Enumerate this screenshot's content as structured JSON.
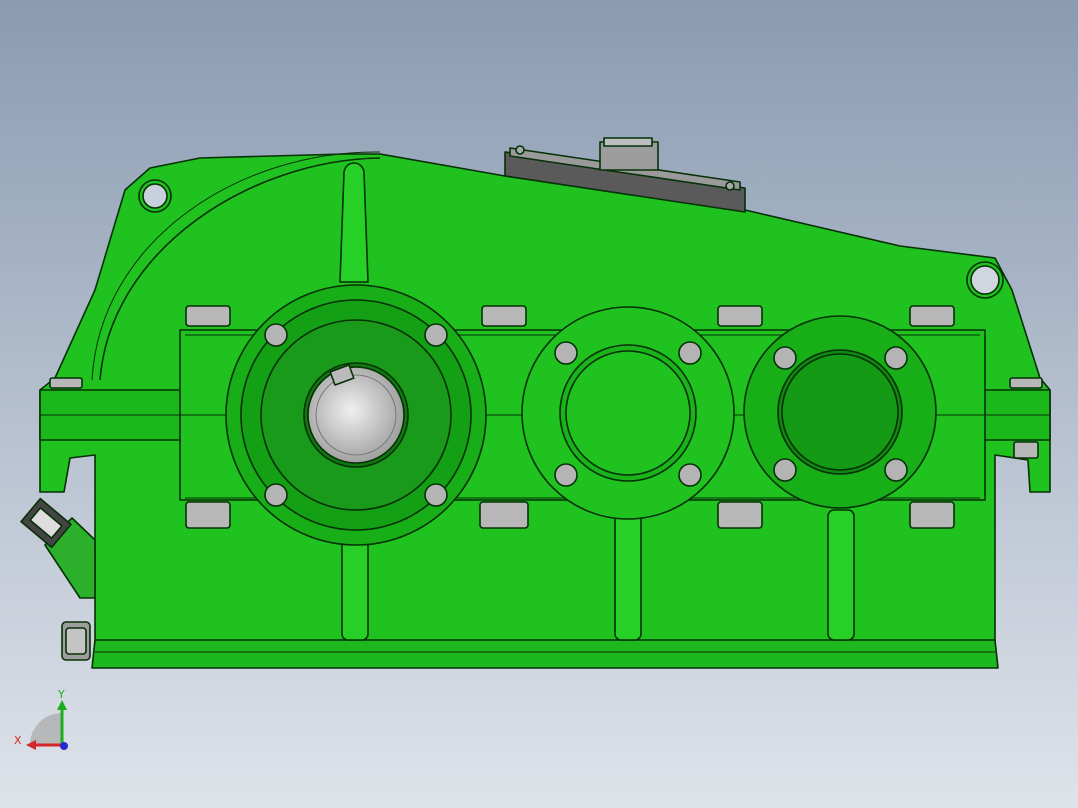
{
  "viewport": {
    "background_top": "#8a9bb2",
    "background_bottom": "#dfe3ea"
  },
  "model": {
    "body_color": "#1fc21f",
    "body_dark": "#0f8a0f",
    "outline_color": "#063006",
    "bolt_color": "#b4b4b4",
    "shaft_color": "#c8c8c8"
  },
  "triad": {
    "x_label": "X",
    "y_label": "Y",
    "x_color": "#d22828",
    "y_color": "#1cae1c",
    "z_color": "#2828d2"
  }
}
